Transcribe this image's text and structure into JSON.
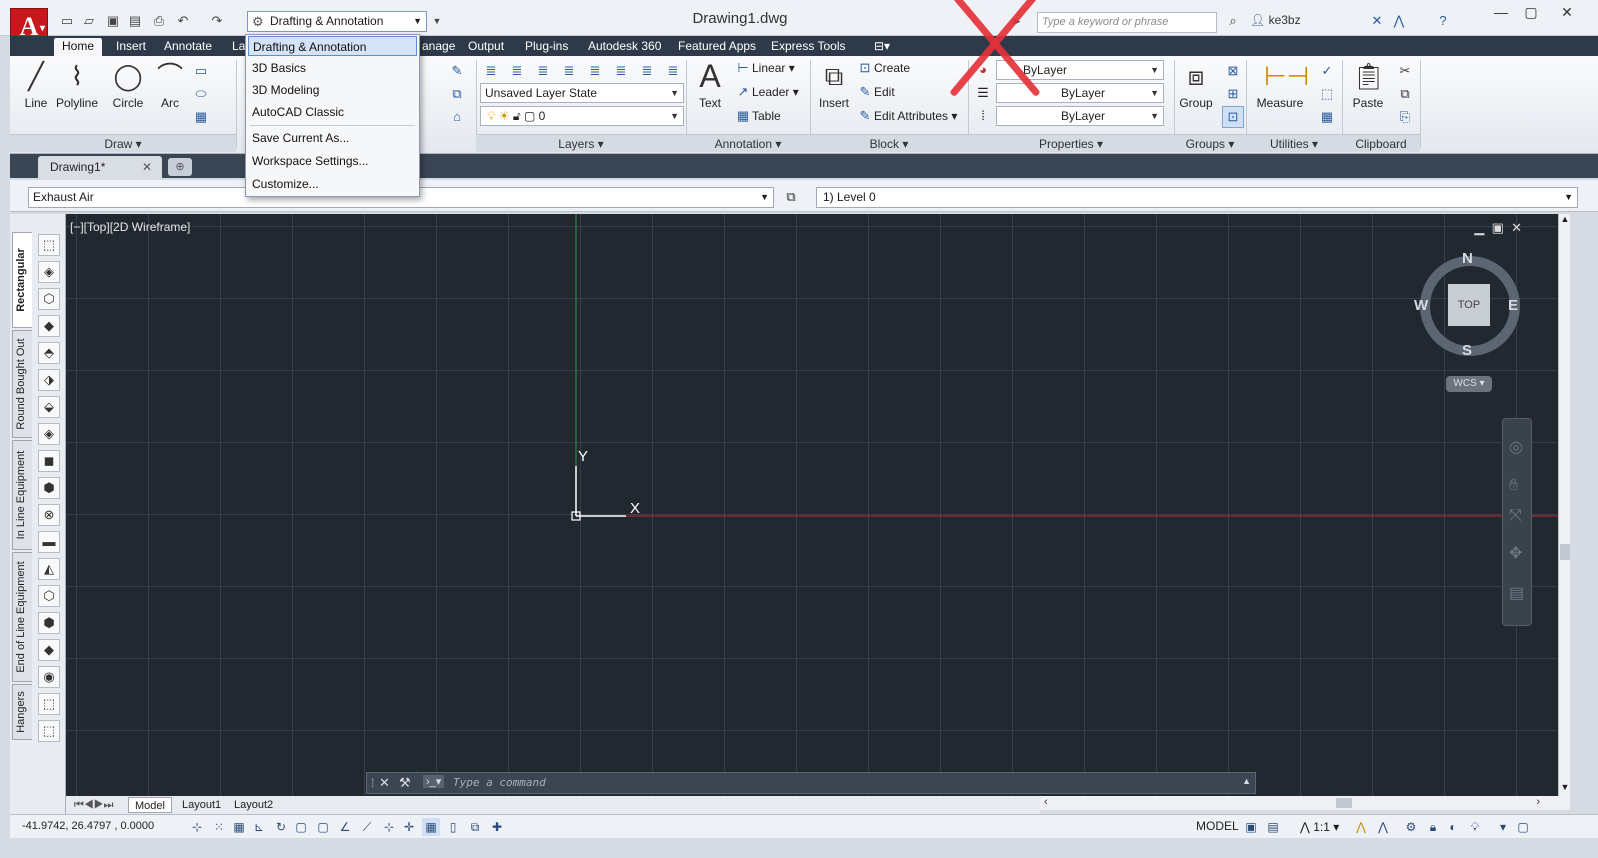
{
  "window": {
    "title": "Drawing1.dwg",
    "workspace_combo": "Drafting & Annotation",
    "search_placeholder": "Type a keyword or phrase",
    "user": "ke3bz"
  },
  "ribbon_tabs": [
    "Home",
    "Insert",
    "Annotate",
    "La",
    "anage",
    "Output",
    "Plug-ins",
    "Autodesk 360",
    "Featured Apps",
    "Express Tools"
  ],
  "workspace_menu": {
    "items": [
      "Drafting & Annotation",
      "3D Basics",
      "3D Modeling",
      "AutoCAD Classic",
      "Save Current As...",
      "Workspace Settings...",
      "Customize..."
    ],
    "selected": "Drafting & Annotation"
  },
  "ribbon": {
    "draw": {
      "title": "Draw",
      "line": "Line",
      "polyline": "Polyline",
      "circle": "Circle",
      "arc": "Arc"
    },
    "layers": {
      "title": "Layers",
      "state": "Unsaved Layer State",
      "current": "0"
    },
    "annotation": {
      "title": "Annotation",
      "text": "Text",
      "linear": "Linear",
      "leader": "Leader",
      "table": "Table"
    },
    "block": {
      "title": "Block",
      "insert": "Insert",
      "create": "Create",
      "edit": "Edit",
      "edit_attributes": "Edit Attributes"
    },
    "properties": {
      "title": "Properties",
      "color": "ByLayer",
      "linetype": "ByLayer",
      "lineweight": "ByLayer"
    },
    "groups": {
      "title": "Groups",
      "group": "Group"
    },
    "utilities": {
      "title": "Utilities",
      "measure": "Measure"
    },
    "clipboard": {
      "title": "Clipboard",
      "paste": "Paste"
    }
  },
  "file_tab": "Drawing1*",
  "layer_bar": {
    "left": "Exhaust Air",
    "right": "1) Level 0"
  },
  "palette_tabs": [
    "Rectangular",
    "Round Bought Out",
    "In Line Equipment",
    "End of Line Equipment",
    "Hangers"
  ],
  "viewport": {
    "label": "[−][Top][2D Wireframe]",
    "ucs_y": "Y",
    "ucs_x": "X",
    "viewcube": {
      "top": "TOP",
      "n": "N",
      "s": "S",
      "e": "E",
      "w": "W",
      "wcs": "WCS"
    }
  },
  "command_line": {
    "placeholder": "Type a command"
  },
  "layout_tabs": [
    "Model",
    "Layout1",
    "Layout2"
  ],
  "status": {
    "coords": "-41.9742, 26.4797 , 0.0000",
    "model": "MODEL",
    "scale": "1:1"
  },
  "colors": {
    "canvas": "#212830",
    "accent_red": "#c8181d",
    "x_axis": "#c0282c",
    "y_axis": "#2e9a3c"
  }
}
